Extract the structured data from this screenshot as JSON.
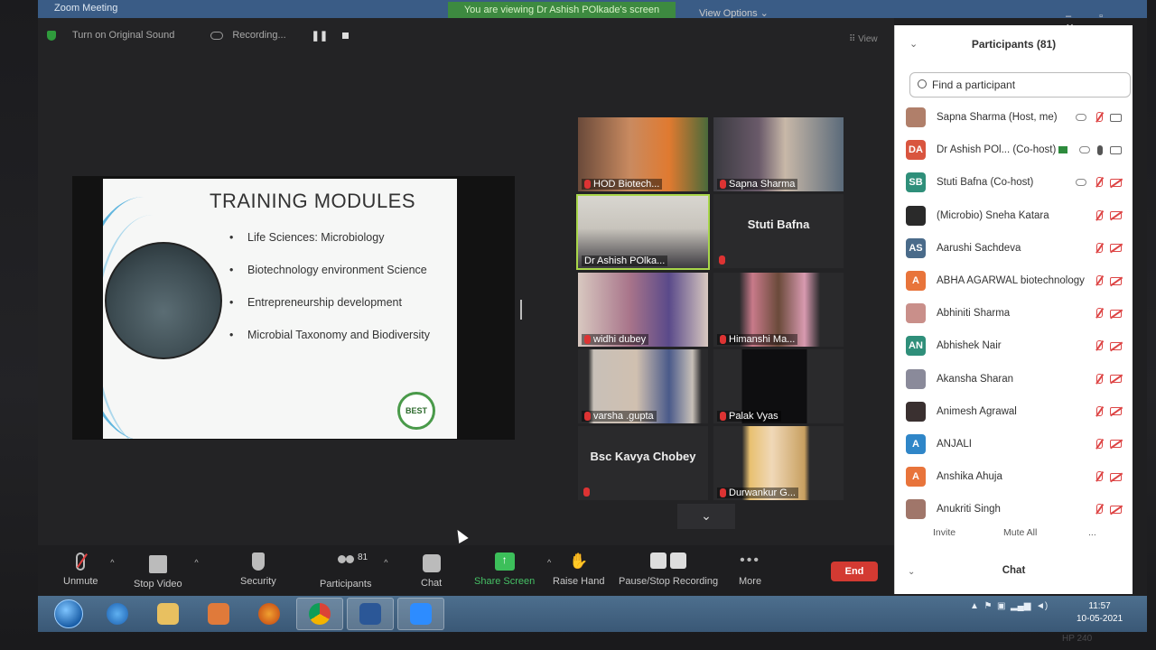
{
  "window": {
    "title": "Zoom Meeting",
    "viewing_banner": "You are viewing Dr Ashish POlkade's screen",
    "view_options": "View Options ⌄",
    "controls": "– ▫ ✕"
  },
  "topbar": {
    "original_sound": "Turn on Original Sound",
    "recording": "Recording...",
    "view": "View"
  },
  "slide": {
    "title": "TRAINING MODULES",
    "bullets": [
      "Life Sciences: Microbiology",
      "Biotechnology environment Science",
      "Entrepreneurship development",
      "Microbial Taxonomy and Biodiversity"
    ],
    "logo_text": "BEST"
  },
  "video_tiles": [
    {
      "name": "HOD Biotech...",
      "video": true
    },
    {
      "name": "Sapna Sharma",
      "video": true
    },
    {
      "name": "Dr Ashish POlka...",
      "video": true,
      "active": true
    },
    {
      "name": "Stuti Bafna",
      "video": false
    },
    {
      "name": "widhi dubey",
      "video": true
    },
    {
      "name": "Himanshi Ma...",
      "video": true
    },
    {
      "name": "varsha .gupta",
      "video": true
    },
    {
      "name": "Palak Vyas",
      "video": true
    },
    {
      "name": "Bsc Kavya Chobey",
      "video": false
    },
    {
      "name": "Durwankur G...",
      "video": true
    }
  ],
  "participants": {
    "header": "Participants (81)",
    "search_placeholder": "Find a participant",
    "list": [
      {
        "initials": "",
        "name": "Sapna Sharma (Host, me)",
        "color": "#b07f6a"
      },
      {
        "initials": "DA",
        "name": "Dr Ashish POl... (Co-host)",
        "color": "#d9553f"
      },
      {
        "initials": "SB",
        "name": "Stuti Bafna (Co-host)",
        "color": "#2f8f7a"
      },
      {
        "initials": "",
        "name": "(Microbio) Sneha Katara",
        "color": "#2a2a2a"
      },
      {
        "initials": "AS",
        "name": "Aarushi Sachdeva",
        "color": "#4a6b8a"
      },
      {
        "initials": "A",
        "name": "ABHA AGARWAL biotechnology",
        "color": "#e8743b"
      },
      {
        "initials": "",
        "name": "Abhiniti Sharma",
        "color": "#c98f8a"
      },
      {
        "initials": "AN",
        "name": "Abhishek Nair",
        "color": "#2f8f7a"
      },
      {
        "initials": "",
        "name": "Akansha Sharan",
        "color": "#8a8a9a"
      },
      {
        "initials": "",
        "name": "Animesh Agrawal",
        "color": "#3a3030"
      },
      {
        "initials": "A",
        "name": "ANJALI",
        "color": "#2f86c8"
      },
      {
        "initials": "A",
        "name": "Anshika Ahuja",
        "color": "#e8743b"
      },
      {
        "initials": "",
        "name": "Anukriti Singh",
        "color": "#a0766a"
      }
    ],
    "invite": "Invite",
    "mute_all": "Mute All",
    "more": "...",
    "chat": "Chat"
  },
  "toolbar": {
    "unmute": "Unmute",
    "stop_video": "Stop Video",
    "security": "Security",
    "participants": "Participants",
    "participants_count": "81",
    "chat": "Chat",
    "share_screen": "Share Screen",
    "raise_hand": "Raise Hand",
    "pause_recording": "Pause/Stop Recording",
    "more": "More",
    "end": "End"
  },
  "taskbar": {
    "time": "11:57",
    "date": "10-05-2021"
  },
  "bezel": "HP 240"
}
